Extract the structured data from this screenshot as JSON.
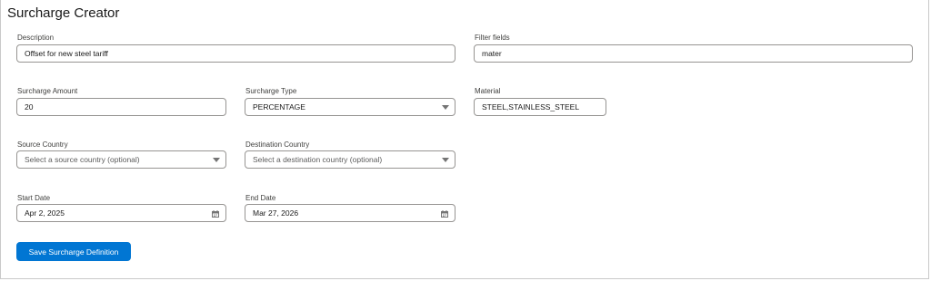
{
  "header": {
    "title": "Surcharge Creator"
  },
  "form": {
    "description": {
      "label": "Description",
      "value": "Offset for new steel tariff"
    },
    "filter_fields": {
      "label": "Filter fields",
      "value": "mater"
    },
    "surcharge_amount": {
      "label": "Surcharge Amount",
      "value": "20"
    },
    "surcharge_type": {
      "label": "Surcharge Type",
      "value": "PERCENTAGE"
    },
    "material": {
      "label": "Material",
      "value": "STEEL,STAINLESS_STEEL"
    },
    "source_country": {
      "label": "Source Country",
      "placeholder": "Select a source country (optional)"
    },
    "destination_country": {
      "label": "Destination Country",
      "placeholder": "Select a destination country (optional)"
    },
    "start_date": {
      "label": "Start Date",
      "value": "Apr 2, 2025"
    },
    "end_date": {
      "label": "End Date",
      "value": "Mar 27, 2026"
    },
    "save_label": "Save Surcharge Definition"
  },
  "icons": {
    "dropdown": "chevron-down-icon",
    "date": "calendar-icon"
  },
  "colors": {
    "primary_button": "#0176d3",
    "input_border": "#969492"
  }
}
